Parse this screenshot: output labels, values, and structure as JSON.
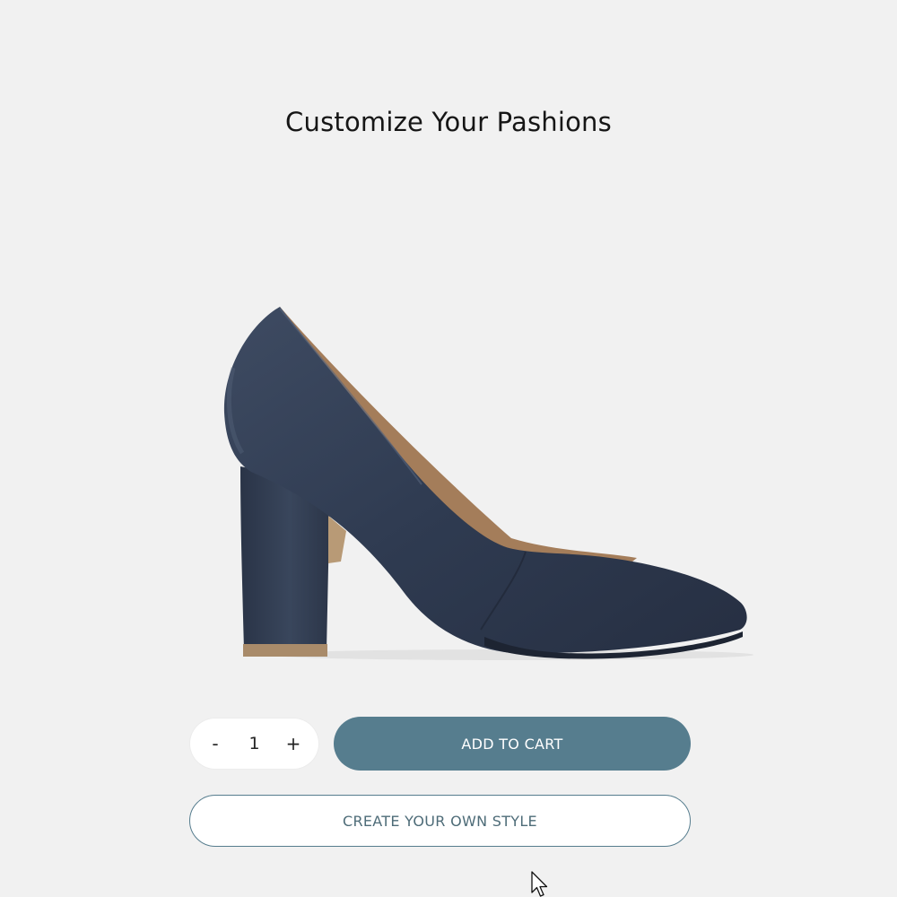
{
  "header": {
    "title": "Customize Your Pashions"
  },
  "product": {
    "image_icon": "navy-block-heel-pump",
    "colors": {
      "shoe": "#2e3a4f",
      "lining": "#a47d5a",
      "heel_tip": "#a98b6a"
    }
  },
  "purchase": {
    "quantity": {
      "decrement_label": "-",
      "value": "1",
      "increment_label": "+"
    },
    "add_to_cart_label": "ADD TO CART",
    "create_style_label": "CREATE YOUR OWN STYLE"
  },
  "colors": {
    "background": "#f1f1f1",
    "accent": "#567d8e"
  },
  "cursor": {
    "icon": "arrow-pointer-icon"
  }
}
